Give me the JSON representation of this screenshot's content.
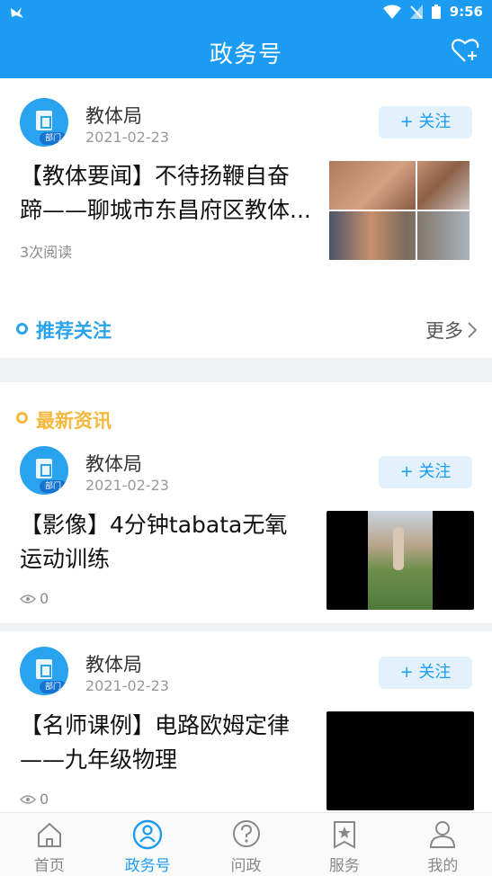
{
  "status_bar": {
    "time": "9:56"
  },
  "header": {
    "title": "政务号",
    "favorite_icon": "heart-plus-icon"
  },
  "top_article": {
    "publisher": "教体局",
    "avatar_tag": "部门",
    "date": "2021-02-23",
    "follow_label": "+ 关注",
    "title_line1": "【教体要闻】不待扬鞭自奋",
    "title_line2": "蹄——聊城市东昌府区教体...",
    "reads": "3次阅读"
  },
  "recommend": {
    "title": "推荐关注",
    "more": "更多"
  },
  "latest": {
    "title": "最新资讯"
  },
  "news": [
    {
      "publisher": "教体局",
      "avatar_tag": "部门",
      "date": "2021-02-23",
      "follow_label": "+ 关注",
      "title_line1": "【影像】4分钟tabata无氧",
      "title_line2": "运动训练",
      "views": "0"
    },
    {
      "publisher": "教体局",
      "avatar_tag": "部门",
      "date": "2021-02-23",
      "follow_label": "+ 关注",
      "title_line1": "【名师课例】电路欧姆定律",
      "title_line2": "——九年级物理",
      "views": "0"
    }
  ],
  "tabs": [
    {
      "label": "首页",
      "icon": "home-icon",
      "active": false
    },
    {
      "label": "政务号",
      "icon": "gov-account-icon",
      "active": true
    },
    {
      "label": "问政",
      "icon": "question-icon",
      "active": false
    },
    {
      "label": "服务",
      "icon": "service-star-icon",
      "active": false
    },
    {
      "label": "我的",
      "icon": "user-icon",
      "active": false
    }
  ],
  "colors": {
    "primary": "#1b9cf2",
    "accent_yellow": "#f5b83d",
    "recommend_blue": "#2aa3ef"
  }
}
